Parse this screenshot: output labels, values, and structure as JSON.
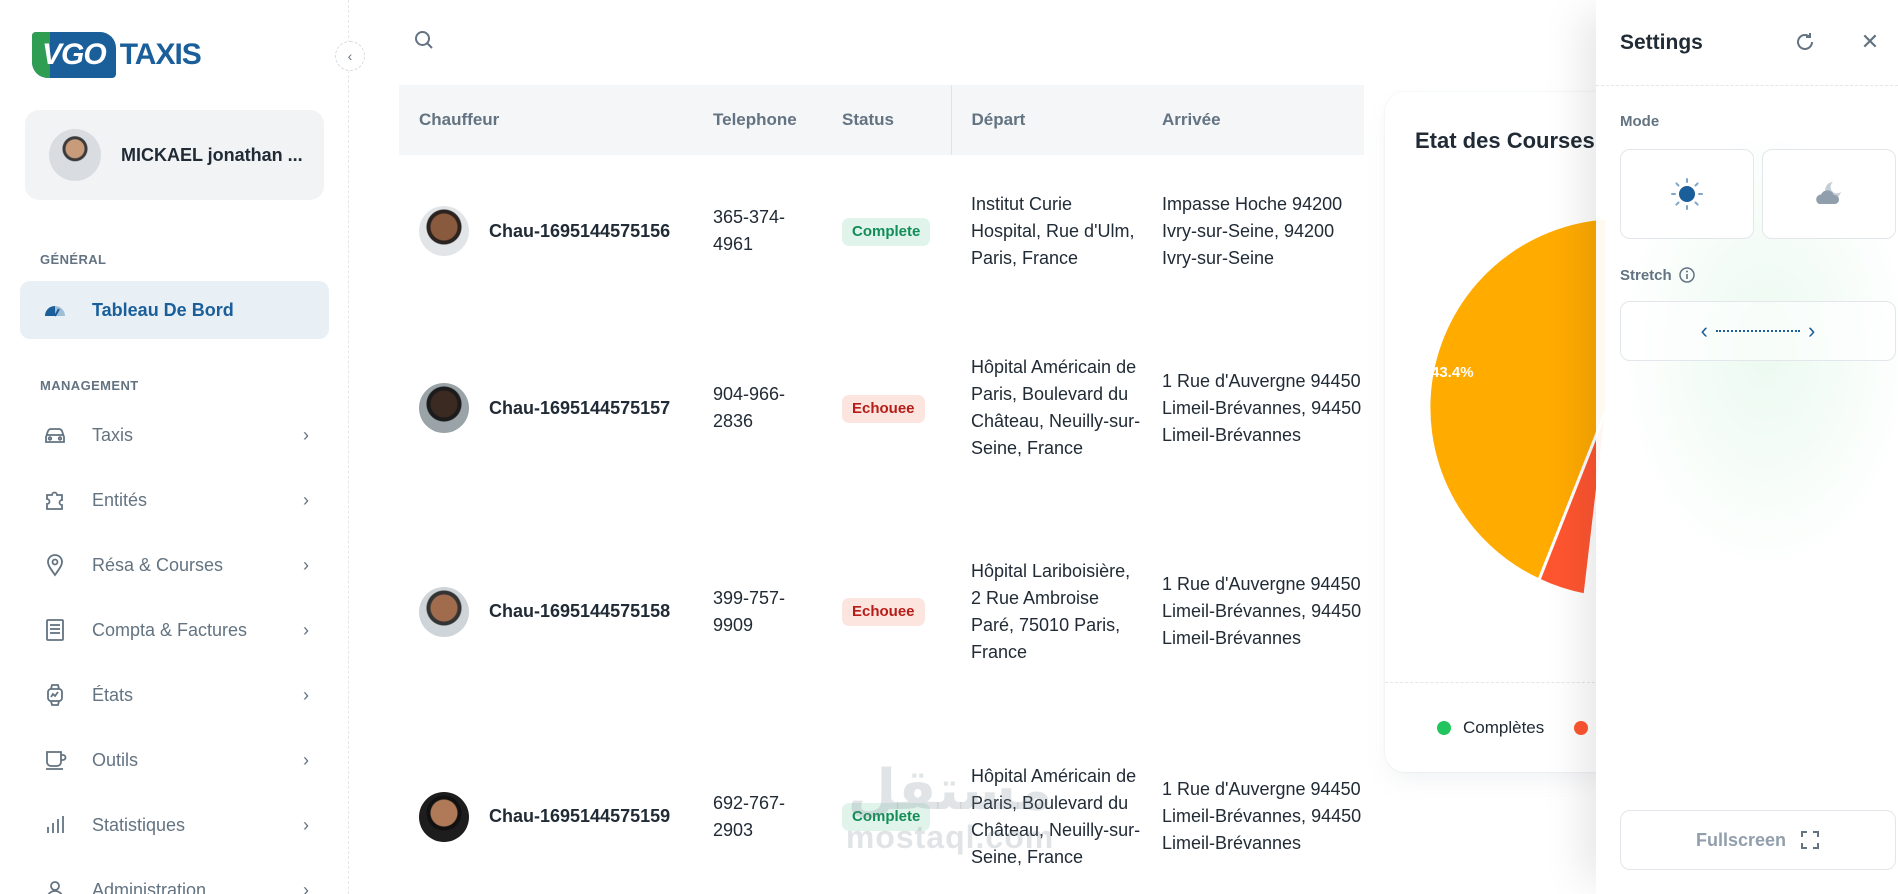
{
  "brand": {
    "badge": "VGO",
    "name": "TAXIS"
  },
  "account": {
    "name": "MICKAEL jonathan ..."
  },
  "nav": {
    "general_header": "GÉNÉRAL",
    "dashboard_label": "Tableau De Bord",
    "management_header": "MANAGEMENT",
    "items": [
      {
        "label": "Taxis",
        "icon": "car-icon"
      },
      {
        "label": "Entités",
        "icon": "puzzle-icon"
      },
      {
        "label": "Résa & Courses",
        "icon": "map-pin-icon"
      },
      {
        "label": "Compta & Factures",
        "icon": "document-icon"
      },
      {
        "label": "États",
        "icon": "watch-icon"
      },
      {
        "label": "Outils",
        "icon": "cup-icon"
      },
      {
        "label": "Statistiques",
        "icon": "bar-chart-icon"
      },
      {
        "label": "Administration",
        "icon": "user-icon"
      }
    ]
  },
  "search": {
    "placeholder": ""
  },
  "table": {
    "headers": {
      "driver": "Chauffeur",
      "phone": "Telephone",
      "status": "Status",
      "departure": "Départ",
      "arrival": "Arrivée"
    },
    "rows": [
      {
        "driver": "Chau-1695144575156",
        "phone": "365-374-4961",
        "status": "Complete",
        "departure": "Institut Curie Hospital, Rue d'Ulm, Paris, France",
        "arrival": "Impasse Hoche 94200 Ivry-sur-Seine, 94200 Ivry-sur-Seine"
      },
      {
        "driver": "Chau-1695144575157",
        "phone": "904-966-2836",
        "status": "Echouee",
        "departure": "Hôpital Américain de Paris, Boulevard du Château, Neuilly-sur-Seine, France",
        "arrival": "1 Rue d'Auvergne 94450 Limeil-Brévannes, 94450 Limeil-Brévannes"
      },
      {
        "driver": "Chau-1695144575158",
        "phone": "399-757-9909",
        "status": "Echouee",
        "departure": "Hôpital Lariboisière, 2 Rue Ambroise Paré, 75010 Paris, France",
        "arrival": "1 Rue d'Auvergne 94450 Limeil-Brévannes, 94450 Limeil-Brévannes"
      },
      {
        "driver": "Chau-1695144575159",
        "phone": "692-767-2903",
        "status": "Complete",
        "departure": "Hôpital Américain de Paris, Boulevard du Château, Neuilly-sur-Seine, France",
        "arrival": "1 Rue d'Auvergne 94450 Limeil-Brévannes, 94450 Limeil-Brévannes"
      }
    ]
  },
  "pie_card": {
    "title": "Etat des Courses",
    "slice_label": "43.4%",
    "legend_completed": "Complètes",
    "colors": {
      "orange": "#FFAB00",
      "red": "#FF5630",
      "green": "#22C55E"
    }
  },
  "settings": {
    "title": "Settings",
    "mode_label": "Mode",
    "stretch_label": "Stretch",
    "fullscreen_label": "Fullscreen"
  },
  "watermark": {
    "arabic": "مستقل",
    "latin": "mostaql.com"
  },
  "colors": {
    "primary": "#1A5E9A",
    "success_bg": "#E1F4EC",
    "success_fg": "#118D57",
    "error_bg": "#FDE5DF",
    "error_fg": "#B71D18"
  }
}
